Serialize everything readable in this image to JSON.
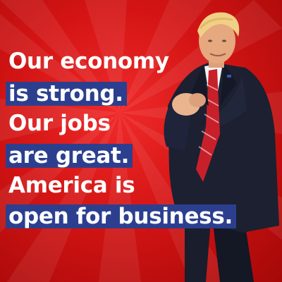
{
  "poster": {
    "lines": [
      {
        "text": "Our economy",
        "highlight": false
      },
      {
        "text": "is strong.",
        "highlight": true
      },
      {
        "text": "Our jobs",
        "highlight": false
      },
      {
        "text": "are great.",
        "highlight": true
      },
      {
        "text": "America is",
        "highlight": false
      },
      {
        "text": "open for business.",
        "highlight": true
      }
    ],
    "colors": {
      "background": "#d41414",
      "highlight": "#2c3f8f",
      "text": "#ffffff"
    }
  }
}
